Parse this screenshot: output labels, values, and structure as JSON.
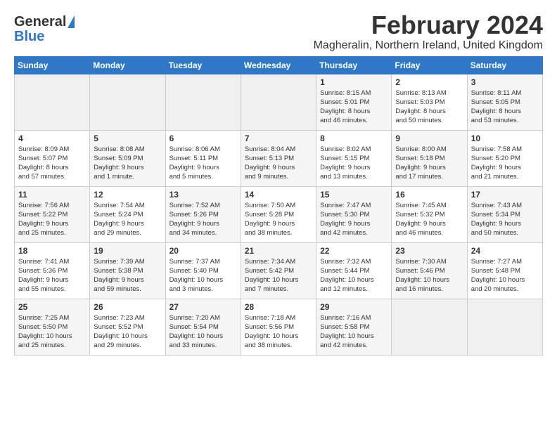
{
  "header": {
    "logo_general": "General",
    "logo_blue": "Blue",
    "month_year": "February 2024",
    "location": "Magheralin, Northern Ireland, United Kingdom"
  },
  "days_of_week": [
    "Sunday",
    "Monday",
    "Tuesday",
    "Wednesday",
    "Thursday",
    "Friday",
    "Saturday"
  ],
  "weeks": [
    {
      "days": [
        {
          "num": "",
          "info": ""
        },
        {
          "num": "",
          "info": ""
        },
        {
          "num": "",
          "info": ""
        },
        {
          "num": "",
          "info": ""
        },
        {
          "num": "1",
          "info": "Sunrise: 8:15 AM\nSunset: 5:01 PM\nDaylight: 8 hours\nand 46 minutes."
        },
        {
          "num": "2",
          "info": "Sunrise: 8:13 AM\nSunset: 5:03 PM\nDaylight: 8 hours\nand 50 minutes."
        },
        {
          "num": "3",
          "info": "Sunrise: 8:11 AM\nSunset: 5:05 PM\nDaylight: 8 hours\nand 53 minutes."
        }
      ]
    },
    {
      "days": [
        {
          "num": "4",
          "info": "Sunrise: 8:09 AM\nSunset: 5:07 PM\nDaylight: 8 hours\nand 57 minutes."
        },
        {
          "num": "5",
          "info": "Sunrise: 8:08 AM\nSunset: 5:09 PM\nDaylight: 9 hours\nand 1 minute."
        },
        {
          "num": "6",
          "info": "Sunrise: 8:06 AM\nSunset: 5:11 PM\nDaylight: 9 hours\nand 5 minutes."
        },
        {
          "num": "7",
          "info": "Sunrise: 8:04 AM\nSunset: 5:13 PM\nDaylight: 9 hours\nand 9 minutes."
        },
        {
          "num": "8",
          "info": "Sunrise: 8:02 AM\nSunset: 5:15 PM\nDaylight: 9 hours\nand 13 minutes."
        },
        {
          "num": "9",
          "info": "Sunrise: 8:00 AM\nSunset: 5:18 PM\nDaylight: 9 hours\nand 17 minutes."
        },
        {
          "num": "10",
          "info": "Sunrise: 7:58 AM\nSunset: 5:20 PM\nDaylight: 9 hours\nand 21 minutes."
        }
      ]
    },
    {
      "days": [
        {
          "num": "11",
          "info": "Sunrise: 7:56 AM\nSunset: 5:22 PM\nDaylight: 9 hours\nand 25 minutes."
        },
        {
          "num": "12",
          "info": "Sunrise: 7:54 AM\nSunset: 5:24 PM\nDaylight: 9 hours\nand 29 minutes."
        },
        {
          "num": "13",
          "info": "Sunrise: 7:52 AM\nSunset: 5:26 PM\nDaylight: 9 hours\nand 34 minutes."
        },
        {
          "num": "14",
          "info": "Sunrise: 7:50 AM\nSunset: 5:28 PM\nDaylight: 9 hours\nand 38 minutes."
        },
        {
          "num": "15",
          "info": "Sunrise: 7:47 AM\nSunset: 5:30 PM\nDaylight: 9 hours\nand 42 minutes."
        },
        {
          "num": "16",
          "info": "Sunrise: 7:45 AM\nSunset: 5:32 PM\nDaylight: 9 hours\nand 46 minutes."
        },
        {
          "num": "17",
          "info": "Sunrise: 7:43 AM\nSunset: 5:34 PM\nDaylight: 9 hours\nand 50 minutes."
        }
      ]
    },
    {
      "days": [
        {
          "num": "18",
          "info": "Sunrise: 7:41 AM\nSunset: 5:36 PM\nDaylight: 9 hours\nand 55 minutes."
        },
        {
          "num": "19",
          "info": "Sunrise: 7:39 AM\nSunset: 5:38 PM\nDaylight: 9 hours\nand 59 minutes."
        },
        {
          "num": "20",
          "info": "Sunrise: 7:37 AM\nSunset: 5:40 PM\nDaylight: 10 hours\nand 3 minutes."
        },
        {
          "num": "21",
          "info": "Sunrise: 7:34 AM\nSunset: 5:42 PM\nDaylight: 10 hours\nand 7 minutes."
        },
        {
          "num": "22",
          "info": "Sunrise: 7:32 AM\nSunset: 5:44 PM\nDaylight: 10 hours\nand 12 minutes."
        },
        {
          "num": "23",
          "info": "Sunrise: 7:30 AM\nSunset: 5:46 PM\nDaylight: 10 hours\nand 16 minutes."
        },
        {
          "num": "24",
          "info": "Sunrise: 7:27 AM\nSunset: 5:48 PM\nDaylight: 10 hours\nand 20 minutes."
        }
      ]
    },
    {
      "days": [
        {
          "num": "25",
          "info": "Sunrise: 7:25 AM\nSunset: 5:50 PM\nDaylight: 10 hours\nand 25 minutes."
        },
        {
          "num": "26",
          "info": "Sunrise: 7:23 AM\nSunset: 5:52 PM\nDaylight: 10 hours\nand 29 minutes."
        },
        {
          "num": "27",
          "info": "Sunrise: 7:20 AM\nSunset: 5:54 PM\nDaylight: 10 hours\nand 33 minutes."
        },
        {
          "num": "28",
          "info": "Sunrise: 7:18 AM\nSunset: 5:56 PM\nDaylight: 10 hours\nand 38 minutes."
        },
        {
          "num": "29",
          "info": "Sunrise: 7:16 AM\nSunset: 5:58 PM\nDaylight: 10 hours\nand 42 minutes."
        },
        {
          "num": "",
          "info": ""
        },
        {
          "num": "",
          "info": ""
        }
      ]
    }
  ]
}
